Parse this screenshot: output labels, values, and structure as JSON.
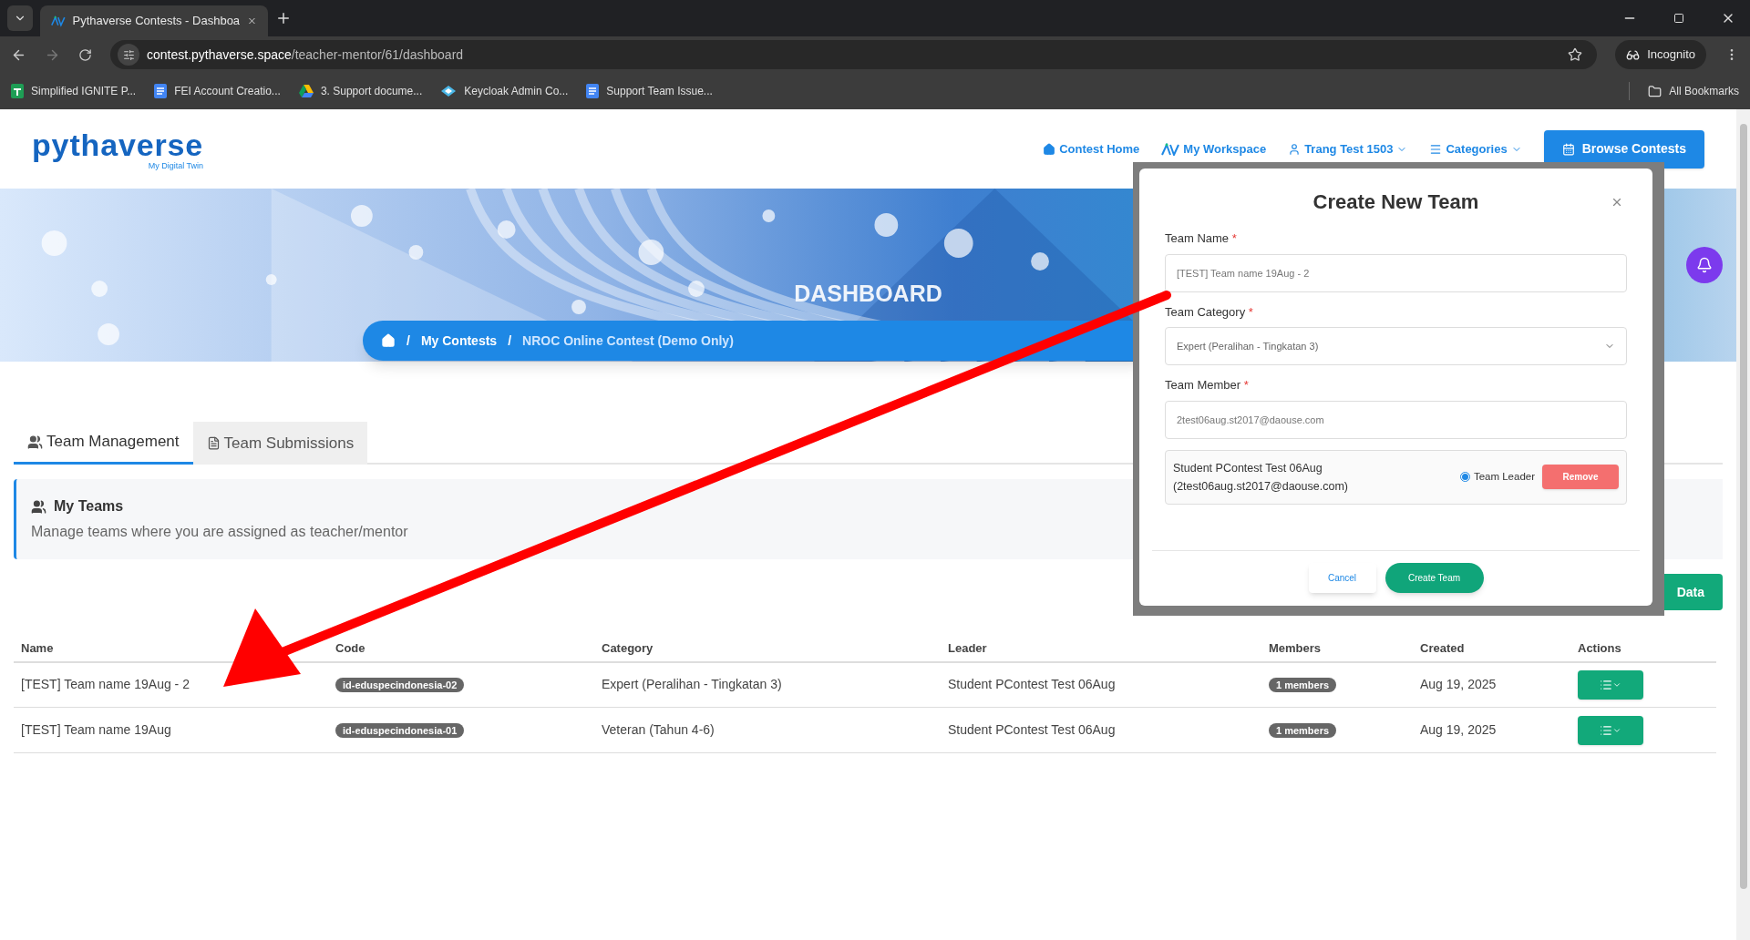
{
  "browser": {
    "tab_title": "Pythaverse Contests - Dashboa",
    "url_host": "contest.pythaverse.space",
    "url_path": "/teacher-mentor/61/dashboard",
    "profile": "Incognito",
    "bookmarks": [
      {
        "label": "Simplified IGNITE P...",
        "kind": "sheet"
      },
      {
        "label": "FEI Account Creatio...",
        "kind": "doc"
      },
      {
        "label": "3. Support docume...",
        "kind": "drive"
      },
      {
        "label": "Keycloak Admin Co...",
        "kind": "key"
      },
      {
        "label": "Support Team Issue...",
        "kind": "doc"
      }
    ],
    "all_bookmarks": "All Bookmarks"
  },
  "header": {
    "logo": "pythaverse",
    "tagline": "My Digital Twin",
    "nav": [
      {
        "label": "Contest Home",
        "kind": "home",
        "dropdown": false
      },
      {
        "label": "My Workspace",
        "kind": "workspace",
        "dropdown": false
      },
      {
        "label": "Trang Test 1503",
        "kind": "user",
        "dropdown": true
      },
      {
        "label": "Categories",
        "kind": "list",
        "dropdown": true
      }
    ],
    "cta": "Browse Contests"
  },
  "banner": {
    "title": "DASHBOARD",
    "breadcrumb": [
      {
        "separator": "/",
        "label": "My Contests",
        "current": false
      },
      {
        "separator": "/",
        "label": "NROC Online Contest (Demo Only)",
        "current": true
      }
    ]
  },
  "tabs": [
    {
      "label": "Team Management",
      "kind": "users",
      "selected": true
    },
    {
      "label": "Team Submissions",
      "kind": "file",
      "selected": false
    }
  ],
  "my_teams": {
    "title": "My Teams",
    "subtitle": "Manage teams where you are assigned as teacher/mentor"
  },
  "data_button": "Data",
  "table": {
    "columns": [
      "Name",
      "Code",
      "Category",
      "Leader",
      "Members",
      "Created",
      "Actions"
    ],
    "rows": [
      {
        "name": "[TEST] Team name 19Aug - 2",
        "code": "id-eduspecindonesia-02",
        "category": "Expert (Peralihan - Tingkatan 3)",
        "leader": "Student PContest Test 06Aug",
        "members": "1 members",
        "created": "Aug 19, 2025"
      },
      {
        "name": "[TEST] Team name 19Aug",
        "code": "id-eduspecindonesia-01",
        "category": "Veteran (Tahun 4-6)",
        "leader": "Student PContest Test 06Aug",
        "members": "1 members",
        "created": "Aug 19, 2025"
      }
    ]
  },
  "modal": {
    "title": "Create New Team",
    "fields": [
      {
        "label": "Team Name",
        "kind": "input",
        "value": "[TEST] Team name 19Aug - 2"
      },
      {
        "label": "Team Category",
        "kind": "select",
        "value": "Expert (Peralihan - Tingkatan 3)"
      },
      {
        "label": "Team Member",
        "kind": "input",
        "value": "2test06aug.st2017@daouse.com"
      }
    ],
    "required_mark": "*",
    "member": {
      "name": "Student PContest Test 06Aug",
      "email": "(2test06aug.st2017@daouse.com)",
      "leader_label": "Team Leader",
      "leader": true,
      "remove": "Remove"
    },
    "cancel": "Cancel",
    "submit": "Create Team"
  }
}
